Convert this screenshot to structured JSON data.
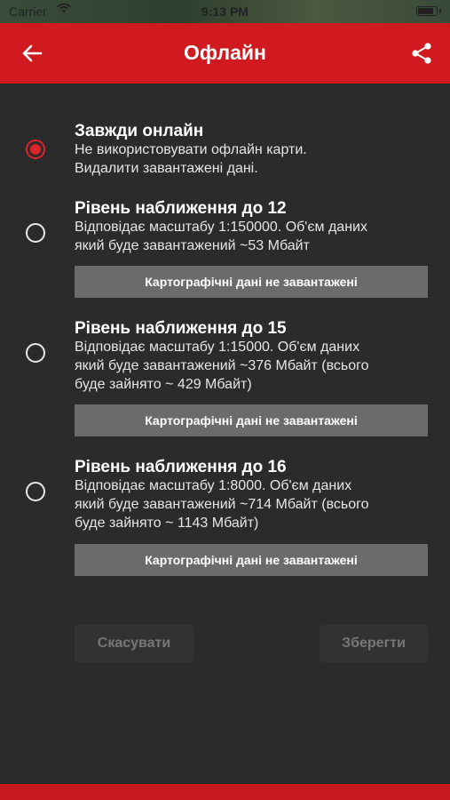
{
  "status_bar": {
    "carrier": "Carrier",
    "time": "9:13 PM"
  },
  "header": {
    "title": "Офлайн",
    "back_icon": "arrow-left-icon",
    "share_icon": "share-icon"
  },
  "colors": {
    "accent": "#d01a20",
    "radio_selected": "#e0242b",
    "background": "#2b2b2b",
    "status_box": "#6b6b6b"
  },
  "options": [
    {
      "title": "Завжди онлайн",
      "desc": [
        "Не використовувати офлайн карти.",
        "Видалити завантажені дані."
      ],
      "selected": true
    },
    {
      "title": "Рівень наближення до 12",
      "desc": [
        "Відповідає масштабу 1:150000. Об'єм даних",
        "який буде завантажений ~53 Мбайт"
      ],
      "status": "Картографічні дані не завантажені",
      "selected": false
    },
    {
      "title": "Рівень наближення до 15",
      "desc": [
        "Відповідає масштабу 1:15000. Об'єм даних",
        "який буде завантажений ~376 Мбайт (всього",
        "буде зайнято ~  429 Мбайт)"
      ],
      "status": "Картографічні дані не завантажені",
      "selected": false
    },
    {
      "title": "Рівень наближення до 16",
      "desc": [
        "Відповідає масштабу 1:8000. Об'єм даних",
        "який буде завантажений ~714 Мбайт (всього",
        "буде зайнято ~  1143 Мбайт)"
      ],
      "status": "Картографічні дані не завантажені",
      "selected": false
    }
  ],
  "actions": {
    "cancel_label": "Скасувати",
    "save_label": "Зберегти"
  }
}
